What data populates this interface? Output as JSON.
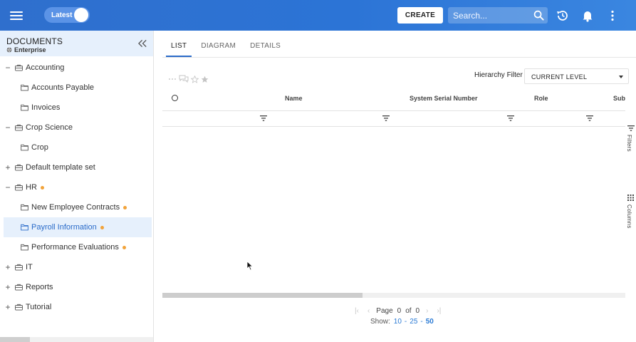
{
  "topbar": {
    "toggle_label": "Latest",
    "create_label": "CREATE",
    "search_placeholder": "Search..."
  },
  "sidebar": {
    "title": "DOCUMENTS",
    "subtitle": "Enterprise",
    "items": [
      {
        "label": "Accounting",
        "expander": "−",
        "level": 0,
        "type": "briefcase",
        "dot": false
      },
      {
        "label": "Accounts Payable",
        "expander": "",
        "level": 1,
        "type": "folder",
        "dot": false
      },
      {
        "label": "Invoices",
        "expander": "",
        "level": 1,
        "type": "folder",
        "dot": false
      },
      {
        "label": "Crop Science",
        "expander": "−",
        "level": 0,
        "type": "briefcase",
        "dot": false
      },
      {
        "label": "Crop",
        "expander": "",
        "level": 1,
        "type": "folder",
        "dot": false
      },
      {
        "label": "Default template set",
        "expander": "+",
        "level": 0,
        "type": "briefcase",
        "dot": false
      },
      {
        "label": "HR",
        "expander": "−",
        "level": 0,
        "type": "briefcase",
        "dot": true
      },
      {
        "label": "New Employee Contracts",
        "expander": "",
        "level": 1,
        "type": "folder",
        "dot": true
      },
      {
        "label": "Payroll Information",
        "expander": "",
        "level": 1,
        "type": "folder",
        "dot": true,
        "selected": true
      },
      {
        "label": "Performance Evaluations",
        "expander": "",
        "level": 1,
        "type": "folder",
        "dot": true
      },
      {
        "label": "IT",
        "expander": "+",
        "level": 0,
        "type": "briefcase",
        "dot": false
      },
      {
        "label": "Reports",
        "expander": "+",
        "level": 0,
        "type": "briefcase",
        "dot": false
      },
      {
        "label": "Tutorial",
        "expander": "+",
        "level": 0,
        "type": "briefcase",
        "dot": false
      }
    ]
  },
  "main": {
    "tabs": [
      {
        "label": "LIST",
        "active": true
      },
      {
        "label": "DIAGRAM",
        "active": false
      },
      {
        "label": "DETAILS",
        "active": false
      }
    ],
    "hierarchy_filter_label": "Hierarchy Filter",
    "hierarchy_filter_value": "CURRENT LEVEL",
    "columns": [
      "Name",
      "System Serial Number",
      "Role",
      "Sub"
    ],
    "side_tabs": {
      "filters": "Filters",
      "columns": "Columns"
    },
    "pager": {
      "page_label": "Page",
      "page_current": "0",
      "of_label": "of",
      "page_total": "0",
      "show_label": "Show:",
      "sizes": [
        "10",
        "25",
        "50"
      ],
      "selected_size": "50"
    }
  },
  "colors": {
    "accent": "#2a6bc9",
    "topbar": "#2c74d6",
    "dot": "#f2a33a"
  }
}
